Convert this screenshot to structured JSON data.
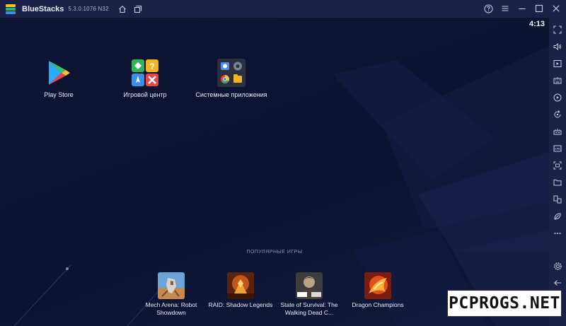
{
  "window": {
    "title": "BlueStacks",
    "version": "5.3.0.1076 N32"
  },
  "clock": "4:13",
  "apps": [
    {
      "label": "Play Store"
    },
    {
      "label": "Игровой центр"
    },
    {
      "label": "Системные приложения"
    }
  ],
  "popular": {
    "title": "ПОПУЛЯРНЫЕ ИГРЫ",
    "games": [
      {
        "label": "Mech Arena: Robot Showdown"
      },
      {
        "label": "RAID: Shadow Legends"
      },
      {
        "label": "State of Survival: The Walking Dead C..."
      },
      {
        "label": "Dragon Champions"
      }
    ]
  },
  "titlebar_icons": [
    "home-icon",
    "multi-instance-icon",
    "help-icon",
    "menu-icon",
    "minimize-icon",
    "maximize-icon",
    "close-icon"
  ],
  "sidebar_icons": [
    "fullscreen-icon",
    "volume-icon",
    "media-icon",
    "keyboard-icon",
    "record-icon",
    "rotate-icon",
    "gamepad-icon",
    "apk-icon",
    "screenshot-icon",
    "folder-icon",
    "multi-instance-icon",
    "eco-icon",
    "more-icon",
    "settings-icon",
    "back-icon",
    "home-icon"
  ],
  "watermark": "PCPROGS.NET",
  "colors": {
    "background": "#0d1330",
    "titlebar": "#1b2147",
    "text": "#e8ebf5"
  }
}
